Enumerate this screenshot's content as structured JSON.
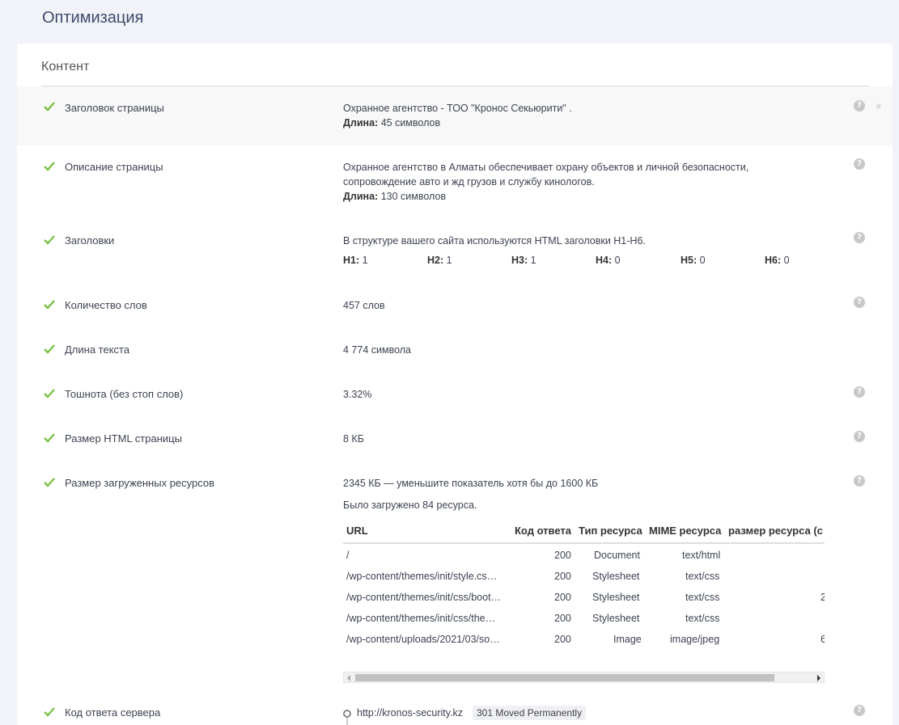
{
  "page_title": "Оптимизация",
  "section_title": "Контент",
  "colors": {
    "check": "#7ac143",
    "help": "#c8c8c8",
    "background": "#f1f3f8"
  },
  "rows": {
    "title": {
      "label": "Заголовок страницы",
      "value": "Охранное агентство - ТОО \"Кронос Секьюрити\" .",
      "length_label": "Длина:",
      "length_value": "45 символов"
    },
    "description": {
      "label": "Описание страницы",
      "value": "Охранное агентство в Алматы обеспечивает охрану объектов и личной безопасности, сопровождение авто и жд грузов и службу кинологов.",
      "length_label": "Длина:",
      "length_value": "130 символов"
    },
    "headings": {
      "label": "Заголовки",
      "value": "В структуре вашего сайта используются HTML заголовки H1-H6.",
      "counts": [
        {
          "tag": "H1:",
          "count": "1"
        },
        {
          "tag": "H2:",
          "count": "1"
        },
        {
          "tag": "H3:",
          "count": "1"
        },
        {
          "tag": "H4:",
          "count": "0"
        },
        {
          "tag": "H5:",
          "count": "0"
        },
        {
          "tag": "H6:",
          "count": "0"
        }
      ]
    },
    "word_count": {
      "label": "Количество слов",
      "value": "457 слов"
    },
    "text_length": {
      "label": "Длина текста",
      "value": "4 774 символа"
    },
    "nausea": {
      "label": "Тошнота (без стоп слов)",
      "value": "3.32%"
    },
    "html_size": {
      "label": "Размер HTML страницы",
      "value": "8 КБ"
    },
    "resources": {
      "label": "Размер загруженных ресурсов",
      "value": "2345 КБ — уменьшите показатель хотя бы до 1600 КБ",
      "loaded": "Было загружено 84 ресурса.",
      "columns": [
        "URL",
        "Код ответа",
        "Тип ресурса",
        "MIME ресурса",
        "размер ресурса (с"
      ],
      "items": [
        {
          "url": "/",
          "code": "200",
          "type": "Document",
          "mime": "text/html",
          "size": ""
        },
        {
          "url": "/wp-content/themes/init/style.cs…",
          "code": "200",
          "type": "Stylesheet",
          "mime": "text/css",
          "size": ""
        },
        {
          "url": "/wp-content/themes/init/css/boot…",
          "code": "200",
          "type": "Stylesheet",
          "mime": "text/css",
          "size": "2"
        },
        {
          "url": "/wp-content/themes/init/css/the…",
          "code": "200",
          "type": "Stylesheet",
          "mime": "text/css",
          "size": ""
        },
        {
          "url": "/wp-content/uploads/2021/03/so…",
          "code": "200",
          "type": "Image",
          "mime": "image/jpeg",
          "size": "6"
        }
      ]
    },
    "server_response": {
      "label": "Код ответа сервера",
      "url": "http://kronos-security.kz",
      "status": "301 Moved Permanently"
    }
  },
  "help_glyph": "?",
  "hash_glyph": "#"
}
